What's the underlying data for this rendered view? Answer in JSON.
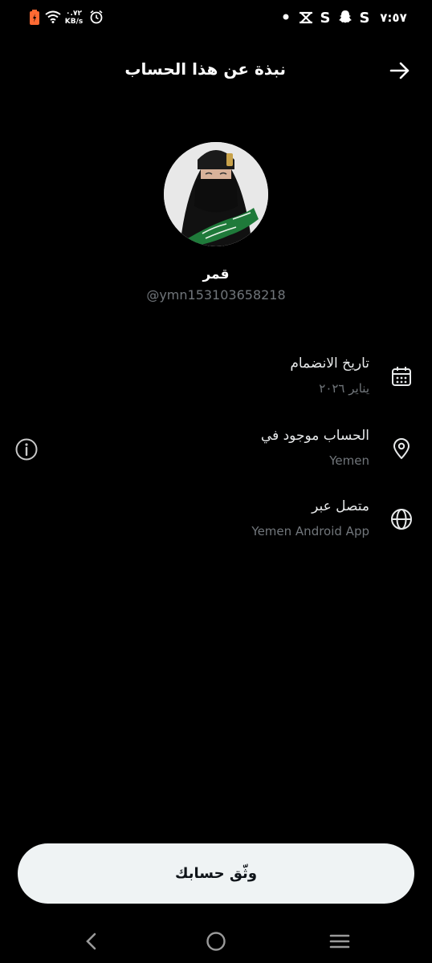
{
  "status_bar": {
    "time": "٧:٥٧",
    "net_speed_value": "٠.٧٢",
    "net_speed_unit": "KB/s"
  },
  "header": {
    "title": "نبذة عن هذا الحساب"
  },
  "profile": {
    "display_name": "قمر",
    "handle": "@ymn153103658218"
  },
  "details": [
    {
      "label": "تاريخ الانضمام",
      "value": "يناير ٢٠٢٦",
      "icon": "calendar-icon"
    },
    {
      "label": "الحساب موجود في",
      "value": "Yemen",
      "icon": "location-pin-icon"
    },
    {
      "label": "متصل عبر",
      "value": "Yemen Android App",
      "icon": "globe-icon"
    }
  ],
  "verify_button": {
    "label": "وثّق حسابك"
  },
  "colors": {
    "background": "#000000",
    "primary_text": "#e7e9ea",
    "secondary_text": "#71767b",
    "button_bg": "#eff3f4"
  }
}
